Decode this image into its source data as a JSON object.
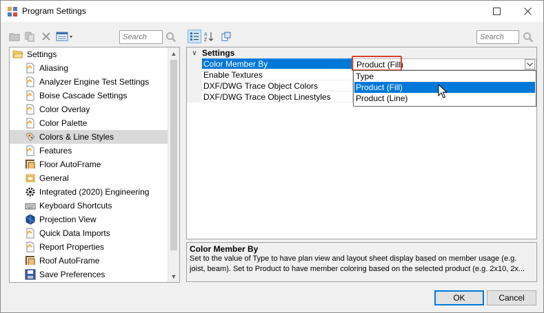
{
  "window": {
    "title": "Program Settings",
    "maximize_icon": "maximize-icon",
    "close_icon": "close-icon"
  },
  "left_toolbar": {
    "icons": [
      "new-folder-icon",
      "copy-icon",
      "delete-icon",
      "view-options-icon"
    ],
    "search_placeholder": "Search"
  },
  "tree": {
    "root": {
      "label": "Settings",
      "icon": "folder-open-icon"
    },
    "items": [
      {
        "label": "Aliasing",
        "icon": "document-icon"
      },
      {
        "label": "Analyzer Engine Test Settings",
        "icon": "document-icon"
      },
      {
        "label": "Boise Cascade Settings",
        "icon": "document-icon"
      },
      {
        "label": "Color Overlay",
        "icon": "document-icon"
      },
      {
        "label": "Color Palette",
        "icon": "document-icon"
      },
      {
        "label": "Colors & Line Styles",
        "icon": "palette-icon"
      },
      {
        "label": "Features",
        "icon": "document-icon"
      },
      {
        "label": "Floor AutoFrame",
        "icon": "frame-icon"
      },
      {
        "label": "General",
        "icon": "general-icon"
      },
      {
        "label": "Integrated (2020) Engineering",
        "icon": "gear-icon"
      },
      {
        "label": "Keyboard Shortcuts",
        "icon": "keyboard-icon"
      },
      {
        "label": "Projection View",
        "icon": "projection-icon"
      },
      {
        "label": "Quick Data Imports",
        "icon": "document-icon"
      },
      {
        "label": "Report Properties",
        "icon": "document-icon"
      },
      {
        "label": "Roof AutoFrame",
        "icon": "frame-icon"
      },
      {
        "label": "Save Preferences",
        "icon": "floppy-disk-icon"
      }
    ],
    "selected_label": "Colors & Line Styles"
  },
  "right_toolbar": {
    "icons": [
      "categorized-icon",
      "sort-alphabetical-icon",
      "property-pages-icon"
    ],
    "search_placeholder": "Search"
  },
  "properties": {
    "category": "Settings",
    "rows": [
      {
        "name": "Color Member By",
        "value": "Product (Fill)"
      },
      {
        "name": "Enable Textures",
        "value": ""
      },
      {
        "name": "DXF/DWG Trace Object Colors",
        "value": ""
      },
      {
        "name": "DXF/DWG Trace Object Linestyles",
        "value": ""
      }
    ],
    "dropdown_options": [
      "Type",
      "Product (Fill)",
      "Product (Line)"
    ],
    "dropdown_selected": "Product (Fill)"
  },
  "description": {
    "title": "Color Member By",
    "text": "Set to the value of Type to have plan view and layout sheet display based on member usage (e.g. joist, beam).  Set to Product to have member coloring based on the selected product (e.g. 2x10, 2x..."
  },
  "buttons": {
    "ok": "OK",
    "cancel": "Cancel"
  },
  "colors": {
    "selection": "#0078d7",
    "highlight_border": "#d9402b"
  }
}
